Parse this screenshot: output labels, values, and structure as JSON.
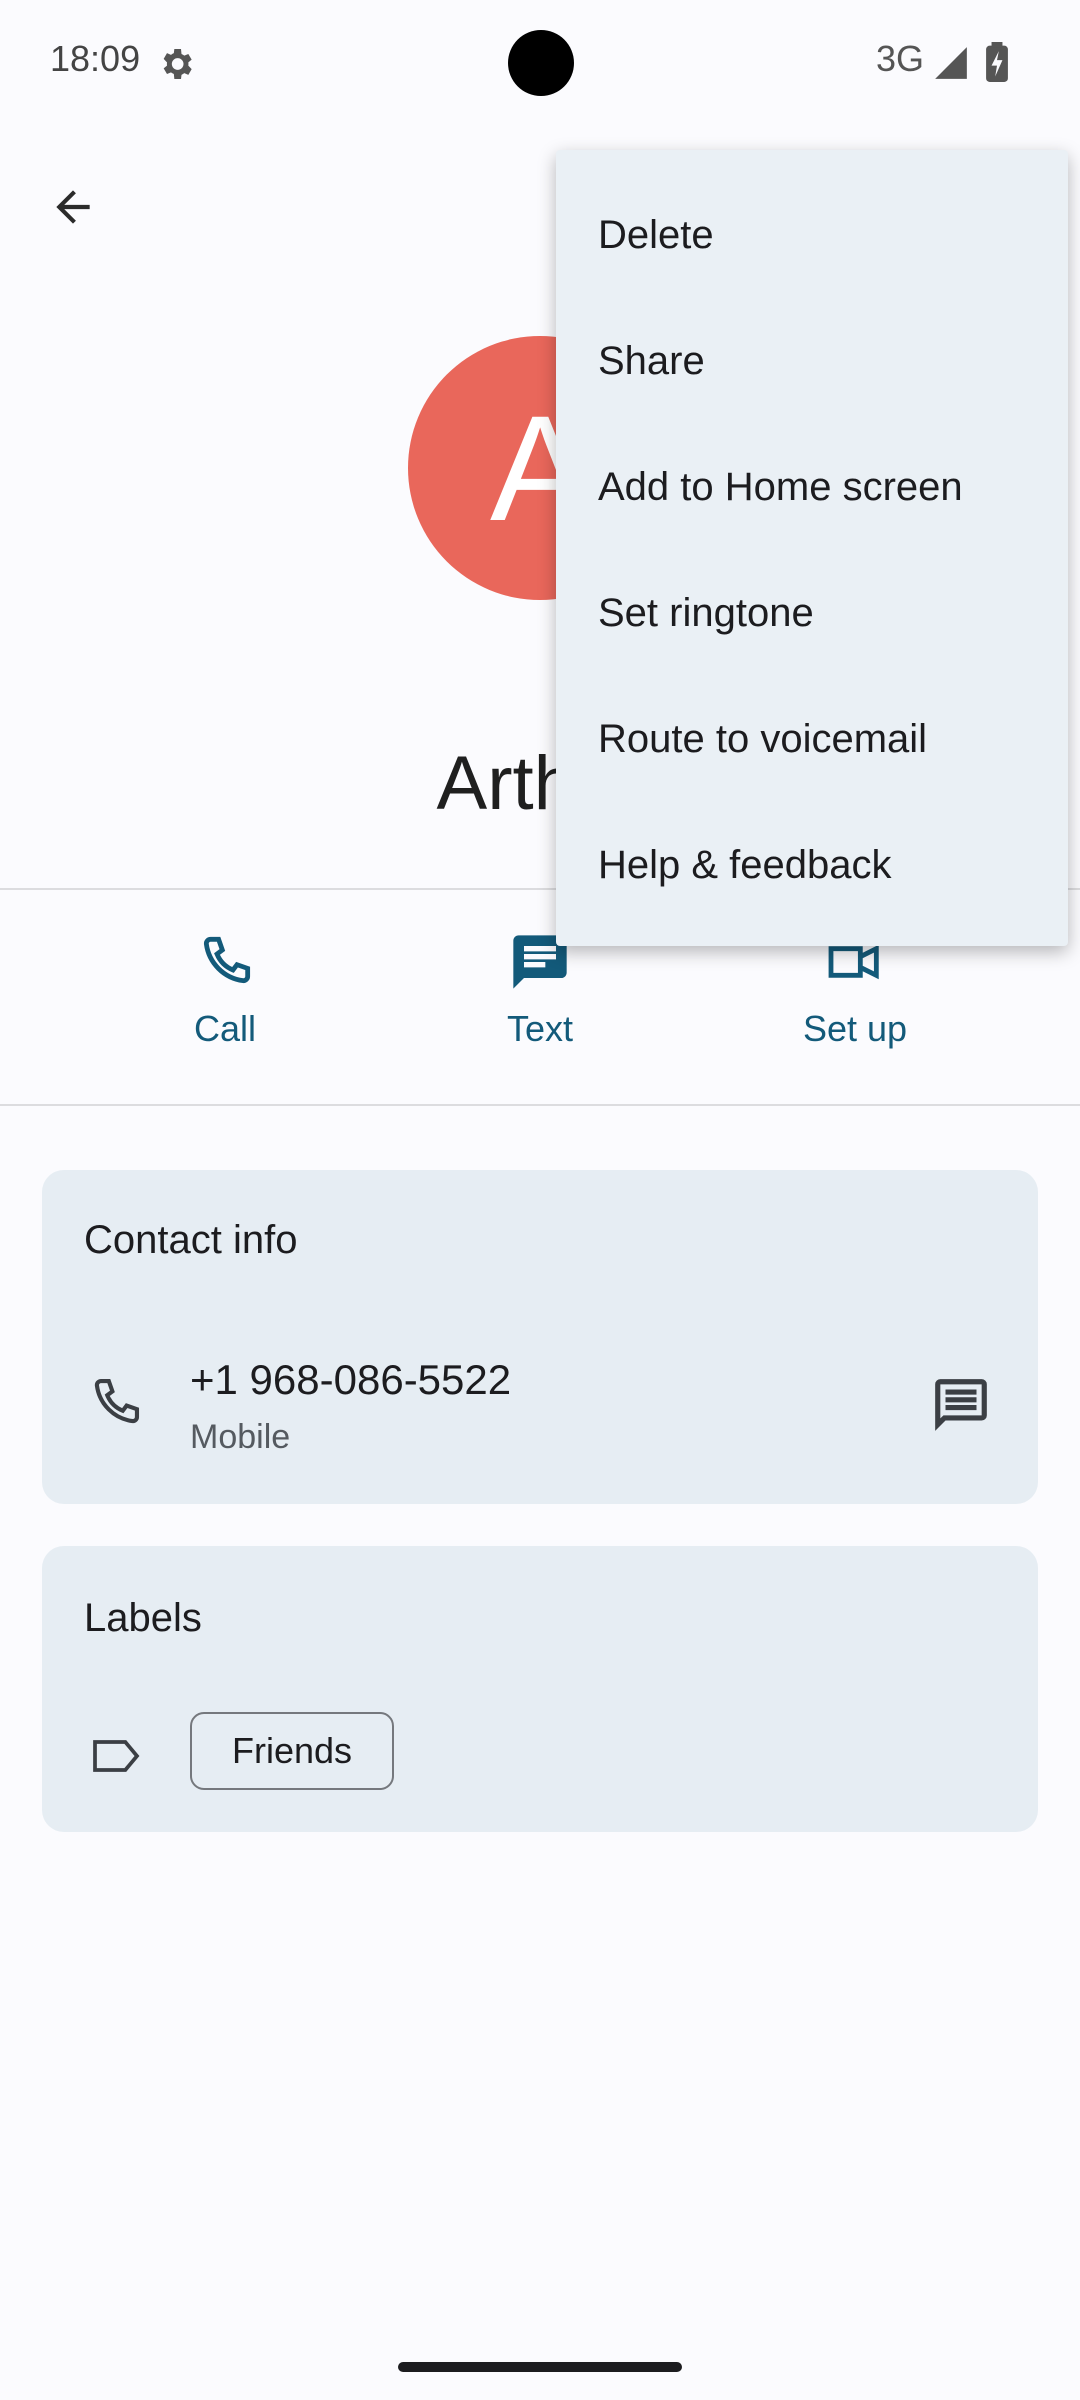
{
  "status_bar": {
    "time": "18:09",
    "network": "3G"
  },
  "contact": {
    "initial": "A",
    "name": "Arthur",
    "avatar_color": "#e9675b"
  },
  "actions": [
    {
      "label": "Call",
      "icon": "phone-icon"
    },
    {
      "label": "Text",
      "icon": "message-icon"
    },
    {
      "label": "Set up",
      "icon": "video-icon"
    }
  ],
  "contact_info": {
    "title": "Contact info",
    "phone_number": "+1 968-086-5522",
    "phone_type": "Mobile"
  },
  "labels": {
    "title": "Labels",
    "chip": "Friends"
  },
  "menu": {
    "items": [
      "Delete",
      "Share",
      "Add to Home screen",
      "Set ringtone",
      "Route to voicemail",
      "Help & feedback"
    ]
  },
  "colors": {
    "accent": "#135a7a",
    "card_bg": "#e6edf3",
    "menu_bg": "#eaf0f5"
  }
}
